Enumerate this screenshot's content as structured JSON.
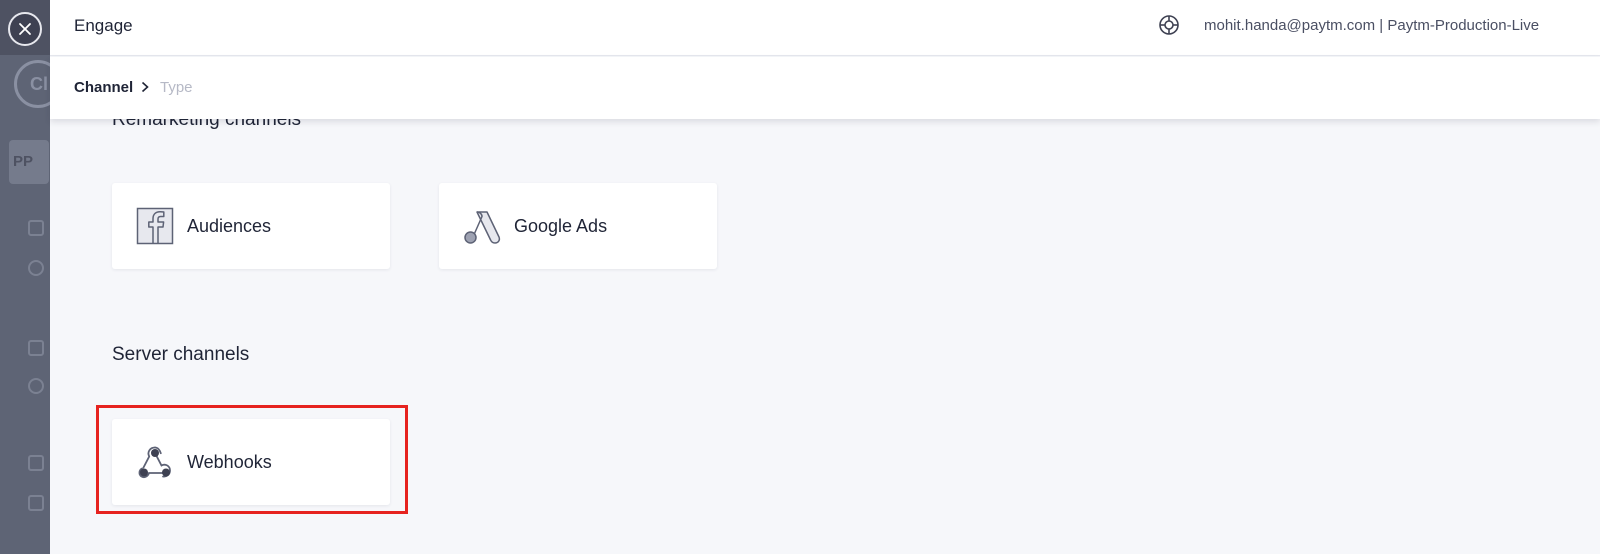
{
  "header": {
    "title": "Engage",
    "account": "mohit.handa@paytm.com | Paytm-Production-Live"
  },
  "breadcrumb": {
    "channel": "Channel",
    "type": "Type"
  },
  "backdrop": {
    "logo_text": "Cl",
    "avatar_initials": "PP"
  },
  "sections": {
    "remarketing": {
      "title": "Remarketing channels",
      "cards": [
        {
          "label": "Audiences",
          "icon": "facebook-icon"
        },
        {
          "label": "Google Ads",
          "icon": "google-ads-icon"
        }
      ]
    },
    "server": {
      "title": "Server channels",
      "cards": [
        {
          "label": "Webhooks",
          "icon": "webhook-icon"
        }
      ]
    }
  },
  "colors": {
    "highlight": "#e6231f",
    "text": "#1f2436",
    "muted": "#b6b9c6",
    "background": "#f6f7fa"
  }
}
